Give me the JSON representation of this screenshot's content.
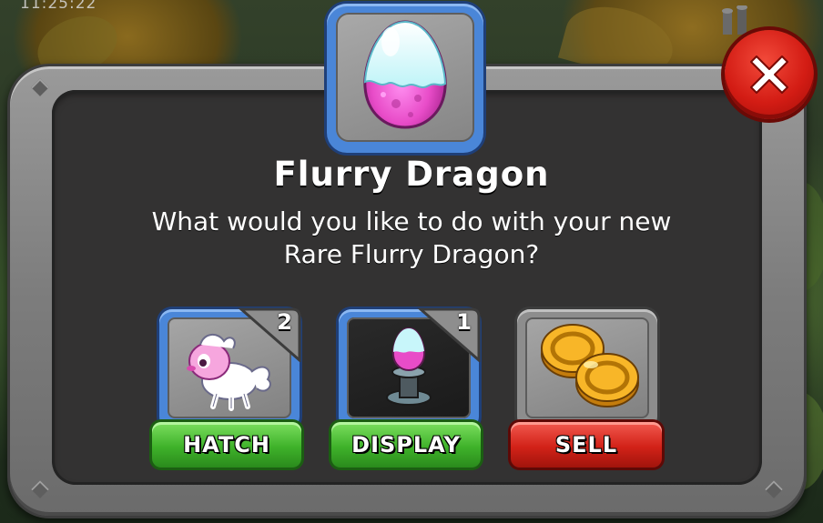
{
  "status_bar": {
    "clock": "11:25:22"
  },
  "dialog": {
    "title": "Flurry Dragon",
    "message_line1": "What would you like to do with your new",
    "message_line2": "Rare Flurry Dragon?"
  },
  "options": [
    {
      "id": "hatch",
      "label": "HATCH",
      "count": "2",
      "icon": "flurry-dragon-baby-icon",
      "color": "#3fb22a"
    },
    {
      "id": "display",
      "label": "DISPLAY",
      "count": "1",
      "icon": "egg-on-pedestal-icon",
      "color": "#3fb22a"
    },
    {
      "id": "sell",
      "label": "SELL",
      "icon": "gold-coins-icon",
      "color": "#d22218"
    }
  ],
  "icons": {
    "header": "flurry-dragon-egg-icon",
    "close": "close-icon"
  },
  "colors": {
    "frame_gray": "#8d8d8d",
    "panel_dark": "#333232",
    "card_blue": "#4a86d8",
    "button_green": "#3fb22a",
    "button_red": "#d22218",
    "egg_pink": "#e84cc8",
    "egg_cyan": "#bff4f8"
  }
}
